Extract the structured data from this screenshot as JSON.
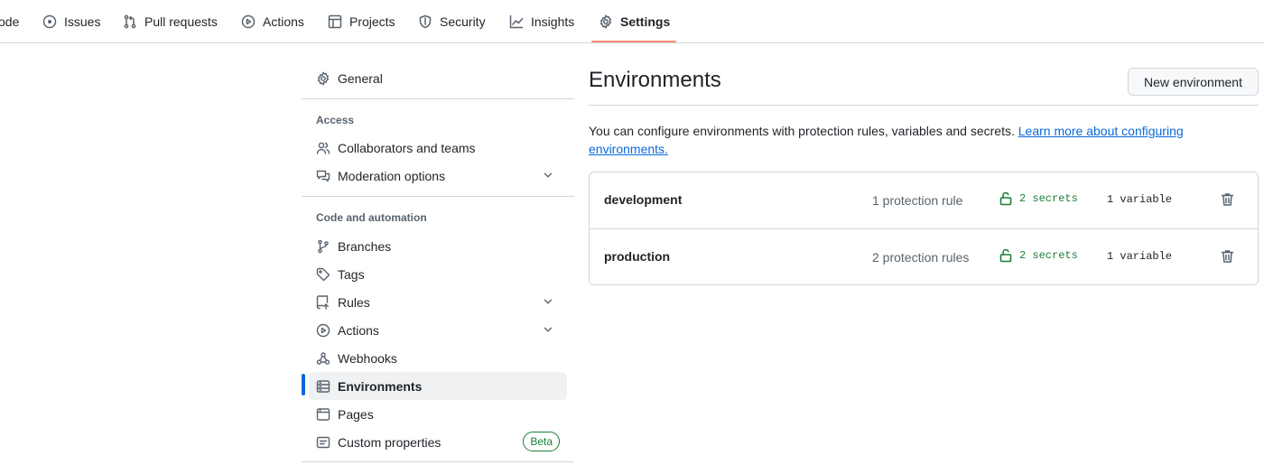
{
  "repo_nav": {
    "items": [
      {
        "label": "ode",
        "icon": "code-icon"
      },
      {
        "label": "Issues",
        "icon": "issue-opened-icon"
      },
      {
        "label": "Pull requests",
        "icon": "git-pull-request-icon"
      },
      {
        "label": "Actions",
        "icon": "play-icon"
      },
      {
        "label": "Projects",
        "icon": "table-icon"
      },
      {
        "label": "Security",
        "icon": "shield-icon"
      },
      {
        "label": "Insights",
        "icon": "graph-icon"
      },
      {
        "label": "Settings",
        "icon": "gear-icon",
        "selected": true
      }
    ],
    "underline_color": "#fd8c73"
  },
  "sidebar": {
    "general": {
      "label": "General",
      "icon": "gear-icon"
    },
    "access_heading": "Access",
    "access_items": [
      {
        "label": "Collaborators and teams",
        "icon": "people-icon"
      },
      {
        "label": "Moderation options",
        "icon": "comment-discussion-icon",
        "expandable": true
      }
    ],
    "code_heading": "Code and automation",
    "code_items": [
      {
        "label": "Branches",
        "icon": "git-branch-icon"
      },
      {
        "label": "Tags",
        "icon": "tag-icon"
      },
      {
        "label": "Rules",
        "icon": "repo-push-icon",
        "expandable": true
      },
      {
        "label": "Actions",
        "icon": "play-icon",
        "expandable": true
      },
      {
        "label": "Webhooks",
        "icon": "webhook-icon"
      },
      {
        "label": "Environments",
        "icon": "server-icon",
        "active": true
      },
      {
        "label": "Pages",
        "icon": "browser-icon"
      },
      {
        "label": "Custom properties",
        "icon": "note-icon",
        "badge": "Beta"
      }
    ],
    "active_color": "#0969da"
  },
  "main": {
    "title": "Environments",
    "new_button": "New environment",
    "description": "You can configure environments with protection rules, variables and secrets.",
    "learn_more": "Learn more about configuring environments.",
    "environments": [
      {
        "name": "development",
        "rules": "1 protection rule",
        "secrets": "2 secrets",
        "variables": "1 variable"
      },
      {
        "name": "production",
        "rules": "2 protection rules",
        "secrets": "2 secrets",
        "variables": "1 variable"
      }
    ],
    "link_color": "#0969da",
    "success_color": "#1a7f37"
  }
}
